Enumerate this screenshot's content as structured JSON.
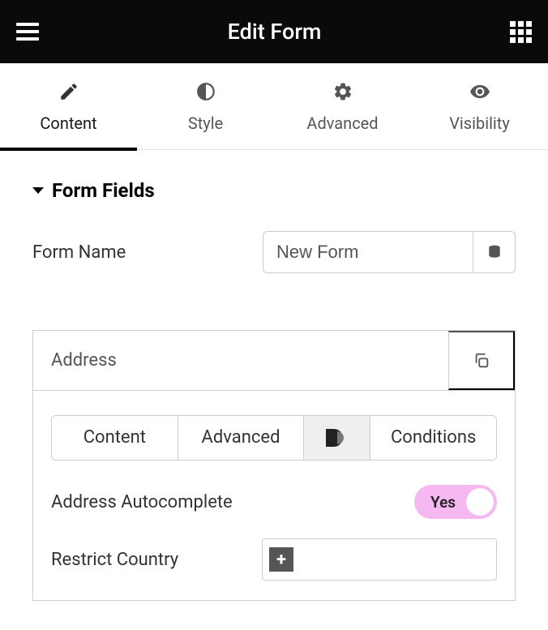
{
  "header": {
    "title": "Edit Form"
  },
  "tabs": [
    {
      "label": "Content",
      "active": true
    },
    {
      "label": "Style",
      "active": false
    },
    {
      "label": "Advanced",
      "active": false
    },
    {
      "label": "Visibility",
      "active": false
    }
  ],
  "section": {
    "title": "Form Fields"
  },
  "formName": {
    "label": "Form Name",
    "value": "New Form"
  },
  "field": {
    "title": "Address",
    "subTabs": [
      {
        "label": "Content"
      },
      {
        "label": "Advanced"
      },
      {
        "label": "D",
        "icon": true,
        "active": true
      },
      {
        "label": "Conditions"
      }
    ],
    "settings": {
      "autocomplete": {
        "label": "Address Autocomplete",
        "value": "Yes"
      },
      "restrictCountry": {
        "label": "Restrict Country",
        "addSymbol": "+"
      }
    }
  }
}
